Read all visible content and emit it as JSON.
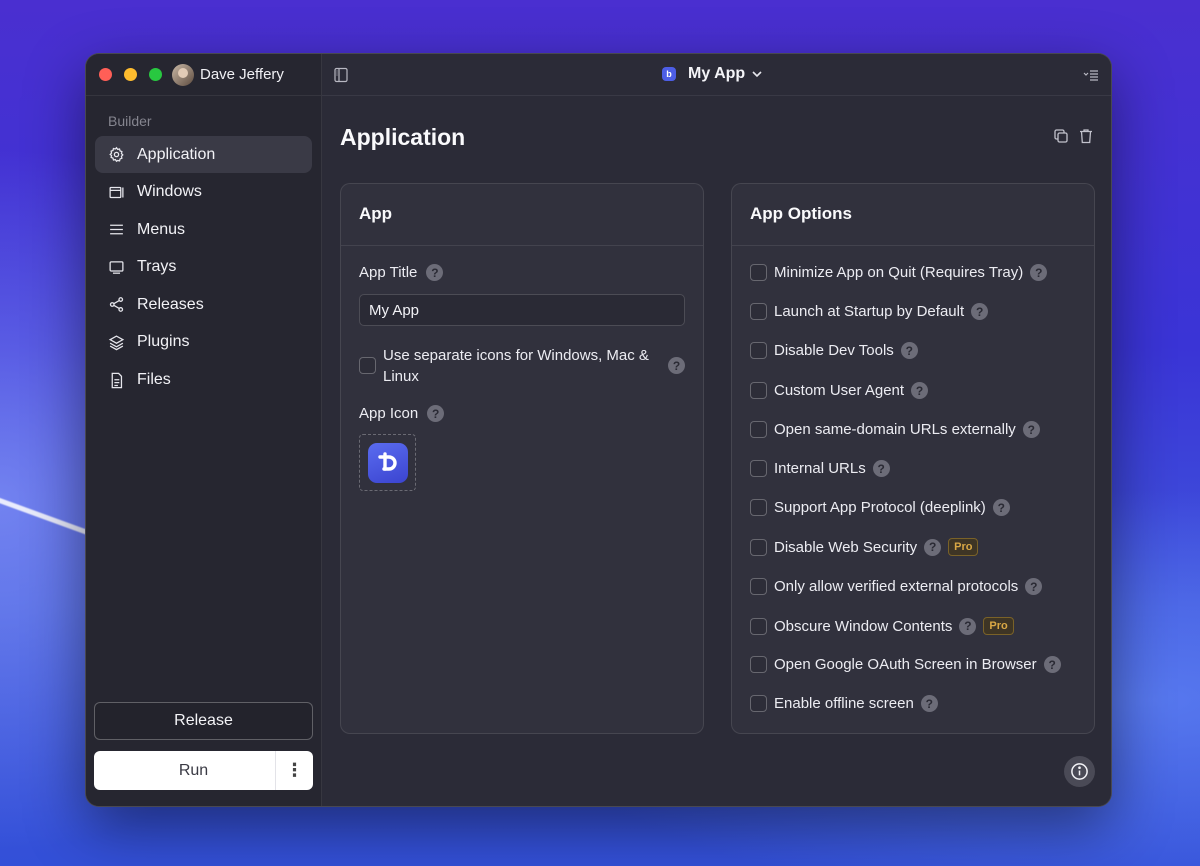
{
  "user": {
    "name": "Dave Jeffery"
  },
  "sidebar": {
    "section_label": "Builder",
    "items": [
      {
        "label": "Application",
        "icon": "gear-icon",
        "active": true
      },
      {
        "label": "Windows",
        "icon": "window-icon"
      },
      {
        "label": "Menus",
        "icon": "menu-lines-icon"
      },
      {
        "label": "Trays",
        "icon": "tray-icon"
      },
      {
        "label": "Releases",
        "icon": "share-nodes-icon"
      },
      {
        "label": "Plugins",
        "icon": "layers-icon"
      },
      {
        "label": "Files",
        "icon": "document-icon"
      }
    ],
    "release_label": "Release",
    "run_label": "Run",
    "run_more_label": "⋮"
  },
  "topbar": {
    "app_name": "My App"
  },
  "page": {
    "title": "Application"
  },
  "app_card": {
    "title": "App",
    "app_title_label": "App Title",
    "app_title_value": "My App",
    "separate_icons_label": "Use separate icons for Windows, Mac & Linux",
    "app_icon_label": "App Icon"
  },
  "options_card": {
    "title": "App Options",
    "pro_label": "Pro",
    "options": [
      {
        "label": "Minimize App on Quit (Requires Tray)",
        "pro": false
      },
      {
        "label": "Launch at Startup by Default",
        "pro": false
      },
      {
        "label": "Disable Dev Tools",
        "pro": false
      },
      {
        "label": "Custom User Agent",
        "pro": false
      },
      {
        "label": "Open same-domain URLs externally",
        "pro": false
      },
      {
        "label": "Internal URLs",
        "pro": false
      },
      {
        "label": "Support App Protocol (deeplink)",
        "pro": false
      },
      {
        "label": "Disable Web Security",
        "pro": true
      },
      {
        "label": "Only allow verified external protocols",
        "pro": false
      },
      {
        "label": "Obscure Window Contents",
        "pro": true
      },
      {
        "label": "Open Google OAuth Screen in Browser",
        "pro": false
      },
      {
        "label": "Enable offline screen",
        "pro": false
      }
    ]
  },
  "help_glyph": "?",
  "colors": {
    "accent": "#4d5ee6",
    "pro": "#d9a845",
    "close": "#ff5f57",
    "minimize": "#febc2e",
    "zoom": "#28c840"
  }
}
